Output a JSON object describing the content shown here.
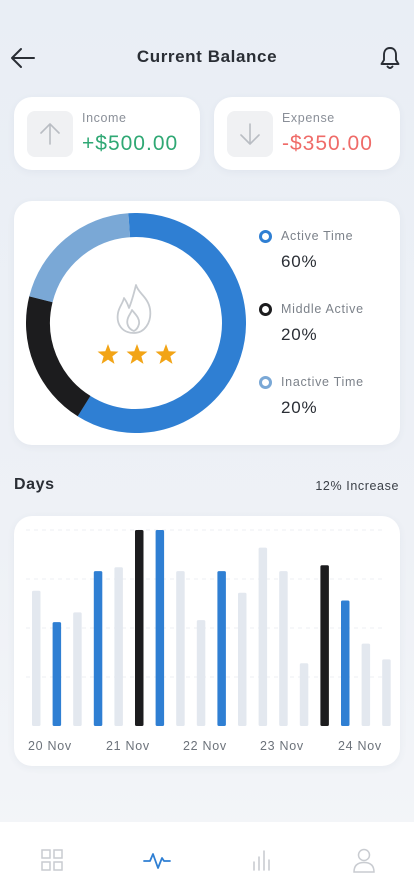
{
  "header": {
    "title": "Current Balance",
    "back_icon": "arrow-left-icon",
    "bell_icon": "bell-icon"
  },
  "income": {
    "label": "Income",
    "amount": "+$500.00",
    "icon": "arrow-up-icon",
    "color": "#2fa874"
  },
  "expense": {
    "label": "Expense",
    "amount": "-$350.00",
    "icon": "arrow-down-icon",
    "color": "#ef6b68"
  },
  "activity": {
    "center_icon": "flame-icon",
    "stars": 3,
    "legend": [
      {
        "name": "Active Time",
        "value": "60%",
        "percent": 60,
        "color": "#2f7fd3"
      },
      {
        "name": "Middle Active",
        "value": "20%",
        "percent": 20,
        "color": "#1c1c1e"
      },
      {
        "name": "Inactive Time",
        "value": "20%",
        "percent": 20,
        "color": "#7aa8d6"
      }
    ]
  },
  "days": {
    "title": "Days",
    "increase": "12% Increase"
  },
  "chart_data": {
    "type": "bar",
    "title": "",
    "categories": [
      "20 Nov",
      "21 Nov",
      "22 Nov",
      "23 Nov",
      "24 Nov"
    ],
    "ylim": [
      0,
      100
    ],
    "grid": true,
    "values": [
      {
        "v": 69,
        "c": "light"
      },
      {
        "v": 53,
        "c": "blue"
      },
      {
        "v": 58,
        "c": "light"
      },
      {
        "v": 79,
        "c": "blue"
      },
      {
        "v": 81,
        "c": "light"
      },
      {
        "v": 100,
        "c": "dark"
      },
      {
        "v": 100,
        "c": "blue"
      },
      {
        "v": 79,
        "c": "light"
      },
      {
        "v": 54,
        "c": "light"
      },
      {
        "v": 79,
        "c": "blue"
      },
      {
        "v": 68,
        "c": "light"
      },
      {
        "v": 91,
        "c": "light"
      },
      {
        "v": 79,
        "c": "light"
      },
      {
        "v": 32,
        "c": "light"
      },
      {
        "v": 82,
        "c": "dark"
      },
      {
        "v": 64,
        "c": "blue"
      },
      {
        "v": 42,
        "c": "light"
      },
      {
        "v": 34,
        "c": "light"
      }
    ],
    "colors": {
      "light": "#e3e8ef",
      "blue": "#2f7fd3",
      "dark": "#1c1c1e"
    }
  },
  "nav": [
    {
      "name": "grid-icon",
      "active": false
    },
    {
      "name": "activity-icon",
      "active": true
    },
    {
      "name": "bar-chart-icon",
      "active": false
    },
    {
      "name": "user-icon",
      "active": false
    }
  ],
  "accent": "#2f7fd3"
}
